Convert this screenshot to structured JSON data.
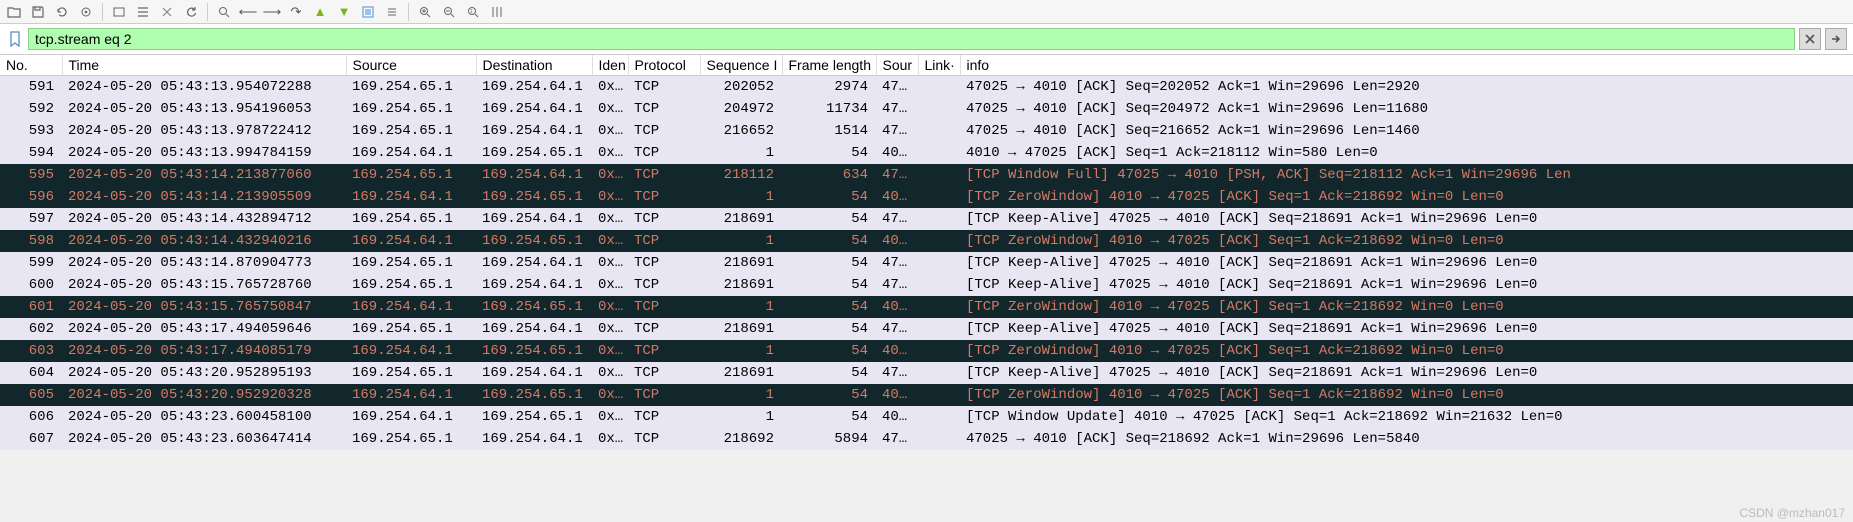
{
  "filter": {
    "value": "tcp.stream eq 2"
  },
  "columns": [
    "No.",
    "Time",
    "Source",
    "Destination",
    "Iden",
    "Protocol",
    "Sequence I",
    "Frame length",
    "Sour",
    "Link·",
    "info"
  ],
  "packets": [
    {
      "no": "591",
      "time": "2024-05-20 05:43:13.954072288",
      "src": "169.254.65.1",
      "dst": "169.254.64.1",
      "iden": "0x…",
      "proto": "TCP",
      "seq": "202052",
      "flen": "2974",
      "sour": "47…",
      "link": "",
      "info": "47025 → 4010 [ACK] Seq=202052 Ack=1 Win=29696 Len=2920",
      "cls": "normal"
    },
    {
      "no": "592",
      "time": "2024-05-20 05:43:13.954196053",
      "src": "169.254.65.1",
      "dst": "169.254.64.1",
      "iden": "0x…",
      "proto": "TCP",
      "seq": "204972",
      "flen": "11734",
      "sour": "47…",
      "link": "",
      "info": "47025 → 4010 [ACK] Seq=204972 Ack=1 Win=29696 Len=11680",
      "cls": "normal"
    },
    {
      "no": "593",
      "time": "2024-05-20 05:43:13.978722412",
      "src": "169.254.65.1",
      "dst": "169.254.64.1",
      "iden": "0x…",
      "proto": "TCP",
      "seq": "216652",
      "flen": "1514",
      "sour": "47…",
      "link": "",
      "info": "47025 → 4010 [ACK] Seq=216652 Ack=1 Win=29696 Len=1460",
      "cls": "normal"
    },
    {
      "no": "594",
      "time": "2024-05-20 05:43:13.994784159",
      "src": "169.254.64.1",
      "dst": "169.254.65.1",
      "iden": "0x…",
      "proto": "TCP",
      "seq": "1",
      "flen": "54",
      "sour": "40…",
      "link": "",
      "info": "4010 → 47025 [ACK] Seq=1 Ack=218112 Win=580 Len=0",
      "cls": "normal"
    },
    {
      "no": "595",
      "time": "2024-05-20 05:43:14.213877060",
      "src": "169.254.65.1",
      "dst": "169.254.64.1",
      "iden": "0x…",
      "proto": "TCP",
      "seq": "218112",
      "flen": "634",
      "sour": "47…",
      "link": "",
      "info": "[TCP Window Full] 47025 → 4010 [PSH, ACK] Seq=218112 Ack=1 Win=29696 Len",
      "cls": "highlight"
    },
    {
      "no": "596",
      "time": "2024-05-20 05:43:14.213905509",
      "src": "169.254.64.1",
      "dst": "169.254.65.1",
      "iden": "0x…",
      "proto": "TCP",
      "seq": "1",
      "flen": "54",
      "sour": "40…",
      "link": "",
      "info": "[TCP ZeroWindow] 4010 → 47025 [ACK] Seq=1 Ack=218692 Win=0 Len=0",
      "cls": "zerowin"
    },
    {
      "no": "597",
      "time": "2024-05-20 05:43:14.432894712",
      "src": "169.254.65.1",
      "dst": "169.254.64.1",
      "iden": "0x…",
      "proto": "TCP",
      "seq": "218691",
      "flen": "54",
      "sour": "47…",
      "link": "",
      "info": "[TCP Keep-Alive] 47025 → 4010 [ACK] Seq=218691 Ack=1 Win=29696 Len=0",
      "cls": "normal"
    },
    {
      "no": "598",
      "time": "2024-05-20 05:43:14.432940216",
      "src": "169.254.64.1",
      "dst": "169.254.65.1",
      "iden": "0x…",
      "proto": "TCP",
      "seq": "1",
      "flen": "54",
      "sour": "40…",
      "link": "",
      "info": "[TCP ZeroWindow] 4010 → 47025 [ACK] Seq=1 Ack=218692 Win=0 Len=0",
      "cls": "zerowin"
    },
    {
      "no": "599",
      "time": "2024-05-20 05:43:14.870904773",
      "src": "169.254.65.1",
      "dst": "169.254.64.1",
      "iden": "0x…",
      "proto": "TCP",
      "seq": "218691",
      "flen": "54",
      "sour": "47…",
      "link": "",
      "info": "[TCP Keep-Alive] 47025 → 4010 [ACK] Seq=218691 Ack=1 Win=29696 Len=0",
      "cls": "normal"
    },
    {
      "no": "600",
      "time": "2024-05-20 05:43:15.765728760",
      "src": "169.254.65.1",
      "dst": "169.254.64.1",
      "iden": "0x…",
      "proto": "TCP",
      "seq": "218691",
      "flen": "54",
      "sour": "47…",
      "link": "",
      "info": "[TCP Keep-Alive] 47025 → 4010 [ACK] Seq=218691 Ack=1 Win=29696 Len=0",
      "cls": "normal"
    },
    {
      "no": "601",
      "time": "2024-05-20 05:43:15.765750847",
      "src": "169.254.64.1",
      "dst": "169.254.65.1",
      "iden": "0x…",
      "proto": "TCP",
      "seq": "1",
      "flen": "54",
      "sour": "40…",
      "link": "",
      "info": "[TCP ZeroWindow] 4010 → 47025 [ACK] Seq=1 Ack=218692 Win=0 Len=0",
      "cls": "zerowin"
    },
    {
      "no": "602",
      "time": "2024-05-20 05:43:17.494059646",
      "src": "169.254.65.1",
      "dst": "169.254.64.1",
      "iden": "0x…",
      "proto": "TCP",
      "seq": "218691",
      "flen": "54",
      "sour": "47…",
      "link": "",
      "info": "[TCP Keep-Alive] 47025 → 4010 [ACK] Seq=218691 Ack=1 Win=29696 Len=0",
      "cls": "normal"
    },
    {
      "no": "603",
      "time": "2024-05-20 05:43:17.494085179",
      "src": "169.254.64.1",
      "dst": "169.254.65.1",
      "iden": "0x…",
      "proto": "TCP",
      "seq": "1",
      "flen": "54",
      "sour": "40…",
      "link": "",
      "info": "[TCP ZeroWindow] 4010 → 47025 [ACK] Seq=1 Ack=218692 Win=0 Len=0",
      "cls": "zerowin"
    },
    {
      "no": "604",
      "time": "2024-05-20 05:43:20.952895193",
      "src": "169.254.65.1",
      "dst": "169.254.64.1",
      "iden": "0x…",
      "proto": "TCP",
      "seq": "218691",
      "flen": "54",
      "sour": "47…",
      "link": "",
      "info": "[TCP Keep-Alive] 47025 → 4010 [ACK] Seq=218691 Ack=1 Win=29696 Len=0",
      "cls": "normal"
    },
    {
      "no": "605",
      "time": "2024-05-20 05:43:20.952920328",
      "src": "169.254.64.1",
      "dst": "169.254.65.1",
      "iden": "0x…",
      "proto": "TCP",
      "seq": "1",
      "flen": "54",
      "sour": "40…",
      "link": "",
      "info": "[TCP ZeroWindow] 4010 → 47025 [ACK] Seq=1 Ack=218692 Win=0 Len=0",
      "cls": "zerowin"
    },
    {
      "no": "606",
      "time": "2024-05-20 05:43:23.600458100",
      "src": "169.254.64.1",
      "dst": "169.254.65.1",
      "iden": "0x…",
      "proto": "TCP",
      "seq": "1",
      "flen": "54",
      "sour": "40…",
      "link": "",
      "info": "[TCP Window Update] 4010 → 47025 [ACK] Seq=1 Ack=218692 Win=21632 Len=0",
      "cls": "normal"
    },
    {
      "no": "607",
      "time": "2024-05-20 05:43:23.603647414",
      "src": "169.254.65.1",
      "dst": "169.254.64.1",
      "iden": "0x…",
      "proto": "TCP",
      "seq": "218692",
      "flen": "5894",
      "sour": "47…",
      "link": "",
      "info": "47025 → 4010 [ACK] Seq=218692 Ack=1 Win=29696 Len=5840",
      "cls": "normal"
    }
  ],
  "watermark": "CSDN @mzhan017"
}
